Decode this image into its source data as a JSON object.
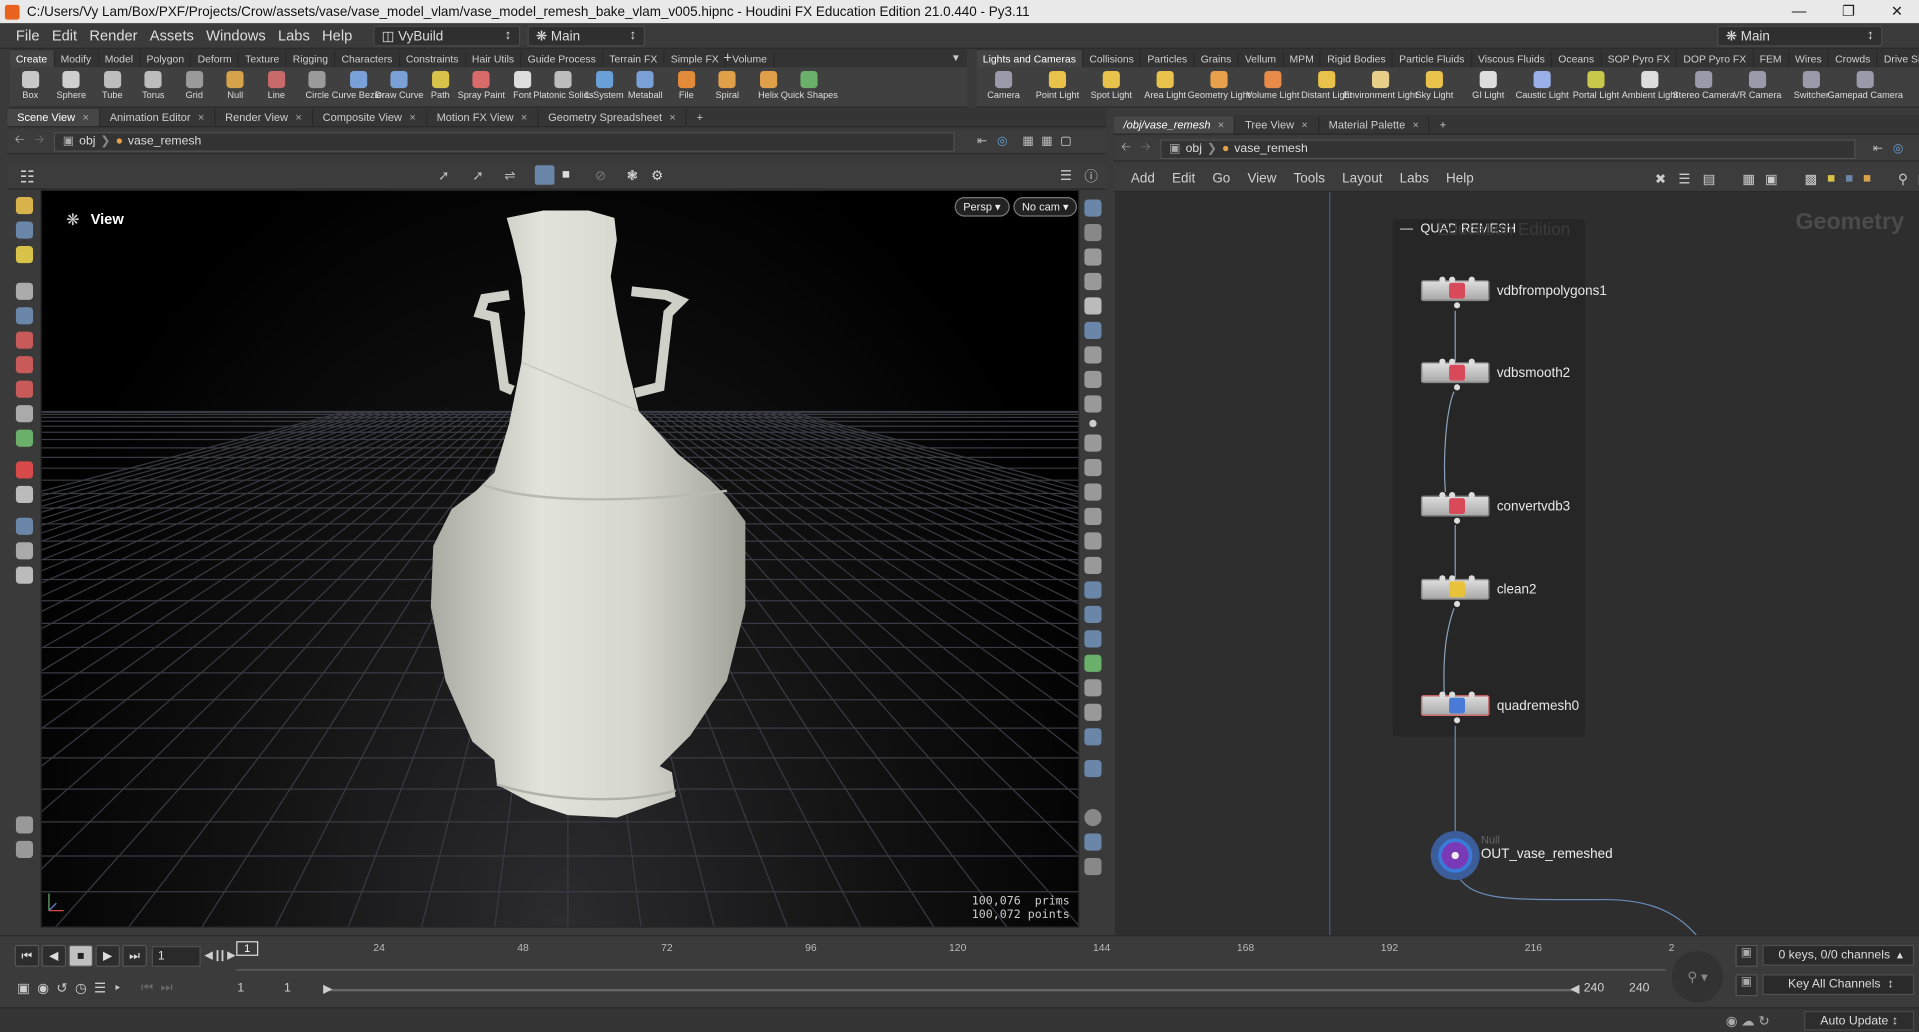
{
  "title_bar": {
    "text": "C:/Users/Vy Lam/Box/PXF/Projects/Crow/assets/vase/vase_model_vlam/vase_model_remesh_bake_vlam_v005.hipnc - Houdini FX Education Edition 21.0.440 - Py3.11"
  },
  "menu": {
    "items": [
      "File",
      "Edit",
      "Render",
      "Assets",
      "Windows",
      "Labs",
      "Help"
    ],
    "desktop": "VyBuild",
    "context": "Main",
    "right_desktop": "Main"
  },
  "shelf_left": {
    "tabs": [
      "Create",
      "Modify",
      "Model",
      "Polygon",
      "Deform",
      "Texture",
      "Rigging",
      "Characters",
      "Constraints",
      "Hair Utils",
      "Guide Process",
      "Terrain FX",
      "Simple FX",
      "Volume"
    ],
    "tools": [
      [
        "Box",
        "#c8c8c8"
      ],
      [
        "Sphere",
        "#cfcfcf"
      ],
      [
        "Tube",
        "#bdbdbd"
      ],
      [
        "Torus",
        "#bdbdbd"
      ],
      [
        "Grid",
        "#9a9a9a"
      ],
      [
        "Null",
        "#d6a24a"
      ],
      [
        "Line",
        "#c86a6a"
      ],
      [
        "Circle",
        "#9a9a9a"
      ],
      [
        "Curve Bezier",
        "#7aa0d8"
      ],
      [
        "Draw Curve",
        "#7aa0d8"
      ],
      [
        "Path",
        "#d8c24a"
      ],
      [
        "Spray Paint",
        "#d86a6a"
      ],
      [
        "Font",
        "#dddddd"
      ],
      [
        "Platonic Solids",
        "#bdbdbd"
      ],
      [
        "L-System",
        "#6aa0d8"
      ],
      [
        "Metaball",
        "#7aa0d8"
      ],
      [
        "File",
        "#e08a3a"
      ],
      [
        "Spiral",
        "#e0a04a"
      ],
      [
        "Helix",
        "#e0a04a"
      ],
      [
        "Quick Shapes",
        "#6ab06a"
      ]
    ]
  },
  "shelf_right": {
    "tabs": [
      "Lights and Cameras",
      "Collisions",
      "Particles",
      "Grains",
      "Vellum",
      "MPM",
      "Rigid Bodies",
      "Particle Fluids",
      "Viscous Fluids",
      "Oceans",
      "SOP Pyro FX",
      "DOP Pyro FX",
      "FEM",
      "Wires",
      "Crowds",
      "Drive Simulation"
    ],
    "tools": [
      [
        "Camera",
        "#9a9aaa"
      ],
      [
        "Point Light",
        "#e8c24a"
      ],
      [
        "Spot Light",
        "#e8c24a"
      ],
      [
        "Area Light",
        "#e8c24a"
      ],
      [
        "Geometry Light",
        "#e8a04a"
      ],
      [
        "Volume Light",
        "#e88a4a"
      ],
      [
        "Distant Light",
        "#e8c24a"
      ],
      [
        "Environment Light",
        "#e8d08a"
      ],
      [
        "Sky Light",
        "#e8c24a"
      ],
      [
        "GI Light",
        "#dddddd"
      ],
      [
        "Caustic Light",
        "#9ab0e8"
      ],
      [
        "Portal Light",
        "#c8c84a"
      ],
      [
        "Ambient Light",
        "#dddddd"
      ],
      [
        "Stereo Camera",
        "#9a9aaa"
      ],
      [
        "VR Camera",
        "#9a9aaa"
      ],
      [
        "Switcher",
        "#9a9aaa"
      ],
      [
        "Gamepad Camera",
        "#9a9aaa"
      ]
    ]
  },
  "left_pane": {
    "tabs": [
      "Scene View",
      "Animation Editor",
      "Render View",
      "Composite View",
      "Motion FX View",
      "Geometry Spreadsheet"
    ],
    "path": {
      "root": "obj",
      "node": "vase_remesh"
    }
  },
  "viewport": {
    "label": "View",
    "persp": "Persp",
    "cam": "No cam",
    "stats": [
      {
        "value": "100,076",
        "unit": "prims"
      },
      {
        "value": "100,072",
        "unit": "points"
      }
    ]
  },
  "right_pane": {
    "tabs": [
      "/obj/vase_remesh",
      "Tree View",
      "Material Palette"
    ],
    "path": {
      "root": "obj",
      "node": "vase_remesh"
    },
    "menu": [
      "Add",
      "Edit",
      "Go",
      "View",
      "Tools",
      "Layout",
      "Labs",
      "Help"
    ]
  },
  "network": {
    "watermark": "Education Edition",
    "context_label": "Geometry",
    "box_title": "QUAD REMESH",
    "nodes": [
      {
        "name": "vdbfrompolygons1",
        "icon": "vdb"
      },
      {
        "name": "vdbsmooth2",
        "icon": "vdb"
      },
      {
        "name": "convertvdb3",
        "icon": "vdb"
      },
      {
        "name": "clean2",
        "icon": "clean"
      },
      {
        "name": "quadremesh0",
        "icon": "quad"
      }
    ],
    "null_node": {
      "type": "Null",
      "name": "OUT_vase_remeshed"
    }
  },
  "timeline": {
    "current_frame": "1",
    "ticks": [
      "24",
      "48",
      "72",
      "96",
      "120",
      "144",
      "168",
      "192",
      "216",
      "2"
    ],
    "range_start": "1",
    "range_start2": "1",
    "range_end": "240",
    "range_end2": "240",
    "keys": "0 keys, 0/0 channels",
    "key_all": "Key All Channels",
    "auto_update": "Auto Update",
    "frame_marker": "1"
  }
}
